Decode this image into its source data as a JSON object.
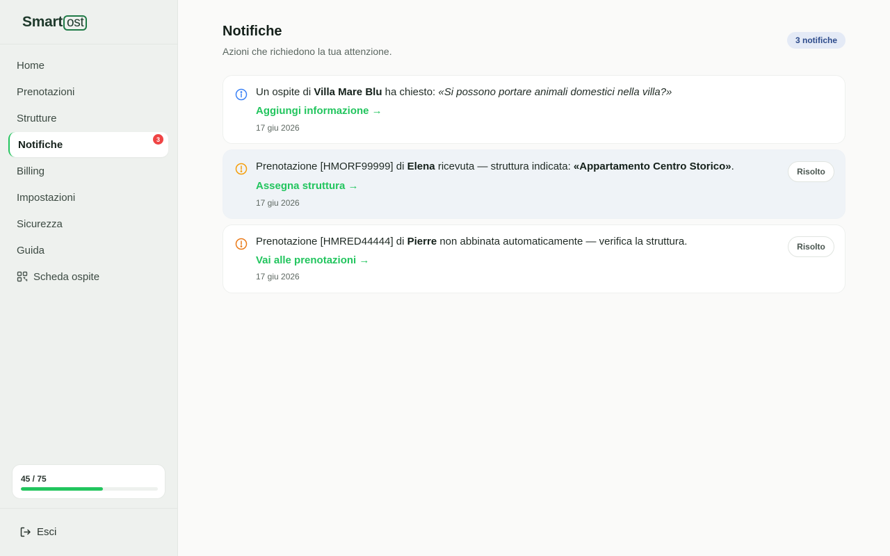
{
  "brand": {
    "name_part1": "Smart",
    "name_part2": "ost"
  },
  "nav": {
    "items": [
      {
        "label": "Home"
      },
      {
        "label": "Prenotazioni"
      },
      {
        "label": "Strutture"
      },
      {
        "label": "Notifiche",
        "badge": "3",
        "active": true
      },
      {
        "label": "Billing"
      },
      {
        "label": "Impostazioni"
      },
      {
        "label": "Sicurezza"
      },
      {
        "label": "Guida"
      },
      {
        "label": "Scheda ospite",
        "icon": "qr-code-icon"
      }
    ]
  },
  "usage": {
    "text": "45 / 75",
    "used": 45,
    "total": 75
  },
  "logout": {
    "label": "Esci",
    "icon": "logout-icon"
  },
  "header": {
    "title": "Notifiche",
    "subtitle": "Azioni che richiedono la tua attenzione.",
    "count": "3 notifiche"
  },
  "notifications": [
    {
      "icon": "info-icon",
      "t1": "Un ospite di ",
      "b1": "Villa Mare Blu",
      "t2": " ha chiesto: ",
      "quote": "«Si possono portare animali domestici nella villa?»",
      "link": "Aggiungi informazione →",
      "date": "17 giu 2026"
    },
    {
      "icon": "warning-icon",
      "t1": "Prenotazione [HMORF99999] di ",
      "b1": "Elena",
      "t2": " ricevuta — struttura indicata: ",
      "b2": "«Appartamento Centro Storico»",
      "t3": ".",
      "link": "Assegna struttura →",
      "date": "17 giu 2026",
      "action": "Risolto"
    },
    {
      "icon": "warning-icon",
      "t1": "Prenotazione [HMRED44444] di ",
      "b1": "Pierre",
      "t2": " non abbinata automaticamente — verifica la struttura.",
      "link": "Vai alle prenotazioni →",
      "date": "17 giu 2026",
      "action": "Risolto"
    }
  ],
  "colors": {
    "accent": "#22c55e",
    "info": "#3b82f6",
    "warning": "#f59e0b",
    "warning_strong": "#ea7a18",
    "badge": "#ef4444",
    "count_pill_bg": "#e4eaf6"
  }
}
